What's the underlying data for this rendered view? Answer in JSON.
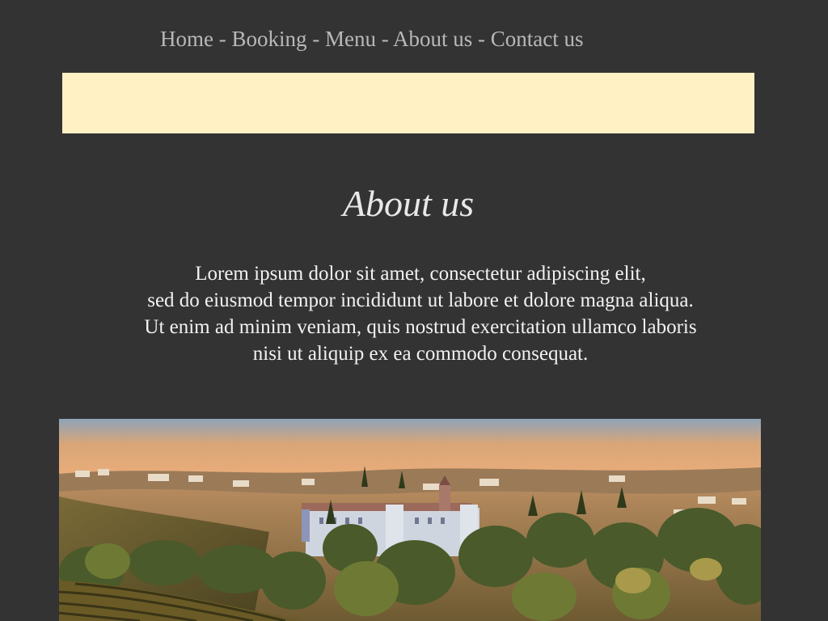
{
  "nav": {
    "items": [
      "Home",
      "Booking",
      "Menu",
      "About us",
      "Contact us"
    ],
    "separator": "-"
  },
  "page": {
    "title": "About us",
    "paragraph_lines": [
      "Lorem ipsum dolor sit amet, consectetur adipiscing elit,",
      "sed do eiusmod tempor incididunt ut labore et dolore magna aliqua.",
      "Ut enim ad minim veniam, quis nostrud exercitation ullamco laboris",
      "nisi ut aliquip ex ea commodo consequat."
    ]
  },
  "colors": {
    "background": "#333333",
    "banner": "#fff1c4",
    "nav_text": "#b8b8b8",
    "body_text": "#f2f2f2"
  }
}
